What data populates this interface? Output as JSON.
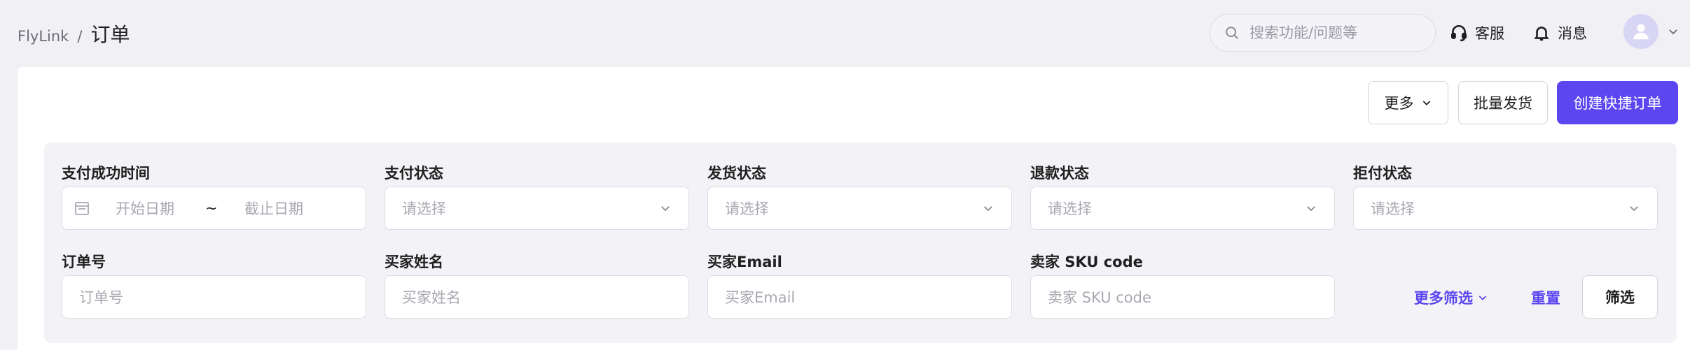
{
  "breadcrumb": {
    "root": "FlyLink",
    "separator": "/",
    "current": "订单"
  },
  "search": {
    "placeholder": "搜索功能/问题等"
  },
  "header_links": {
    "support": "客服",
    "messages": "消息"
  },
  "actions": {
    "more": "更多",
    "batch_ship": "批量发货",
    "create_order": "创建快捷订单"
  },
  "filters": {
    "payment_time": {
      "label": "支付成功时间",
      "start_placeholder": "开始日期",
      "separator": "~",
      "end_placeholder": "截止日期"
    },
    "payment_status": {
      "label": "支付状态",
      "placeholder": "请选择"
    },
    "shipping_status": {
      "label": "发货状态",
      "placeholder": "请选择"
    },
    "refund_status": {
      "label": "退款状态",
      "placeholder": "请选择"
    },
    "chargeback_status": {
      "label": "拒付状态",
      "placeholder": "请选择"
    },
    "order_no": {
      "label": "订单号",
      "placeholder": "订单号"
    },
    "buyer_name": {
      "label": "买家姓名",
      "placeholder": "买家姓名"
    },
    "buyer_email": {
      "label": "买家Email",
      "placeholder": "买家Email"
    },
    "seller_sku": {
      "label": "卖家 SKU code",
      "placeholder": "卖家 SKU code"
    }
  },
  "filter_actions": {
    "more_filters": "更多筛选",
    "reset": "重置",
    "apply": "筛选"
  },
  "colors": {
    "primary": "#5b46f0",
    "background": "#f0f0f5"
  }
}
